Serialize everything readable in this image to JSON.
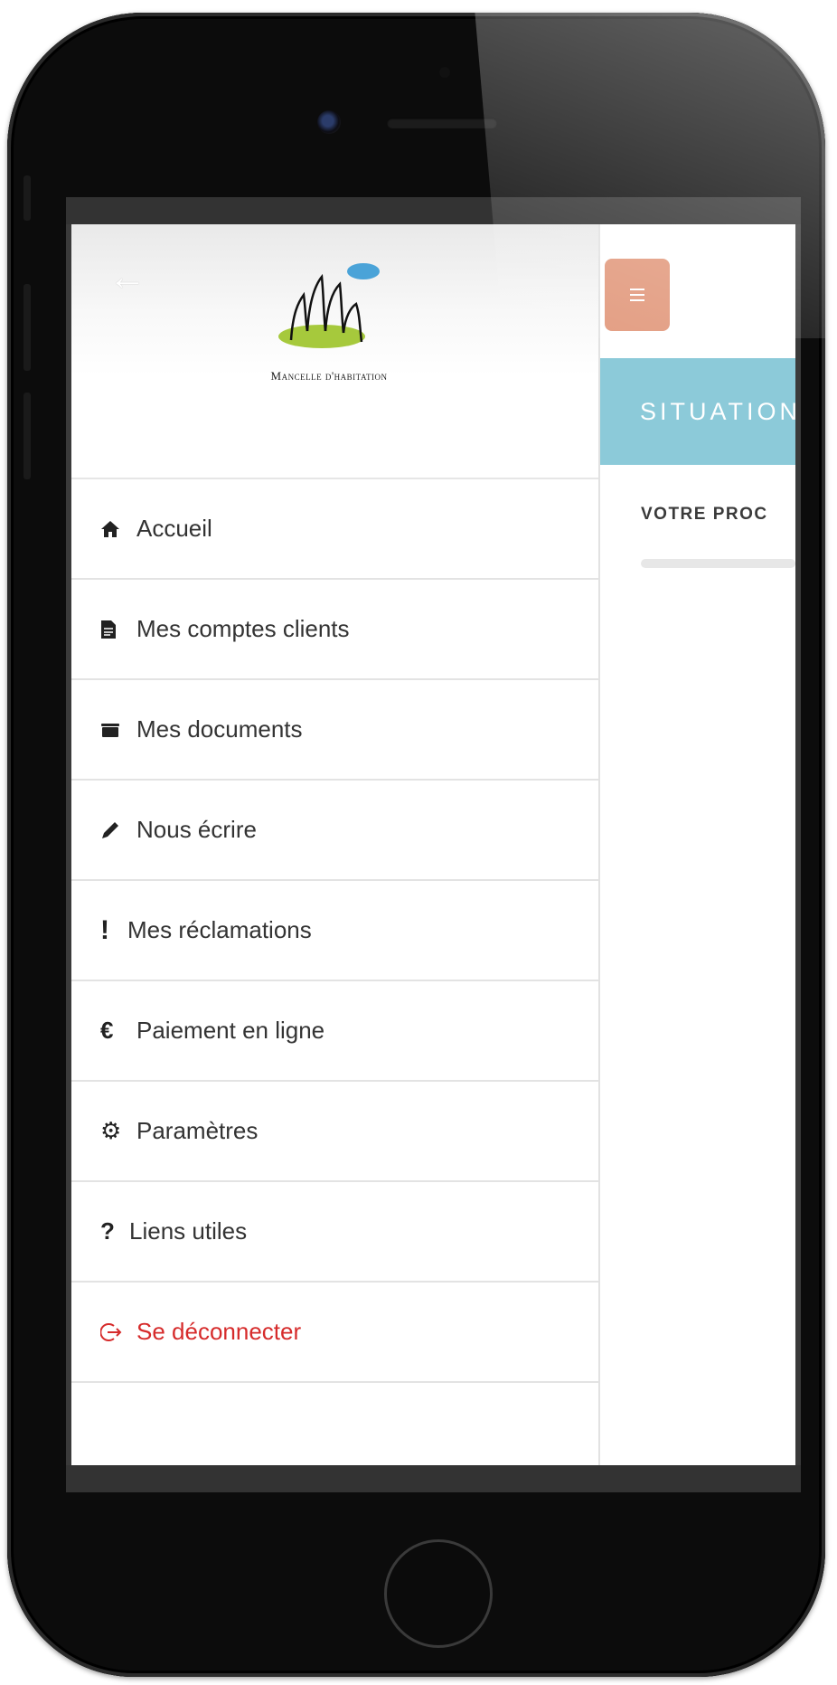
{
  "brand": {
    "logo_text": "Mancelle d'habitation"
  },
  "drawer": {
    "back_icon": "arrow-left-icon",
    "items": [
      {
        "label": "Accueil",
        "icon": "home-icon"
      },
      {
        "label": "Mes comptes clients",
        "icon": "document-icon"
      },
      {
        "label": "Mes documents",
        "icon": "folder-icon"
      },
      {
        "label": "Nous écrire",
        "icon": "pencil-icon"
      },
      {
        "label": "Mes réclamations",
        "icon": "exclamation-icon"
      },
      {
        "label": "Paiement en ligne",
        "icon": "euro-icon"
      },
      {
        "label": "Paramètres",
        "icon": "gear-icon"
      },
      {
        "label": "Liens utiles",
        "icon": "question-icon"
      },
      {
        "label": "Se déconnecter",
        "icon": "logout-icon"
      }
    ]
  },
  "main": {
    "banner_title": "SITUATION",
    "section_title": "VOTRE PROC"
  },
  "colors": {
    "accent_button": "#e29a7e",
    "banner": "#8ccad9",
    "logout": "#d62b2b"
  }
}
